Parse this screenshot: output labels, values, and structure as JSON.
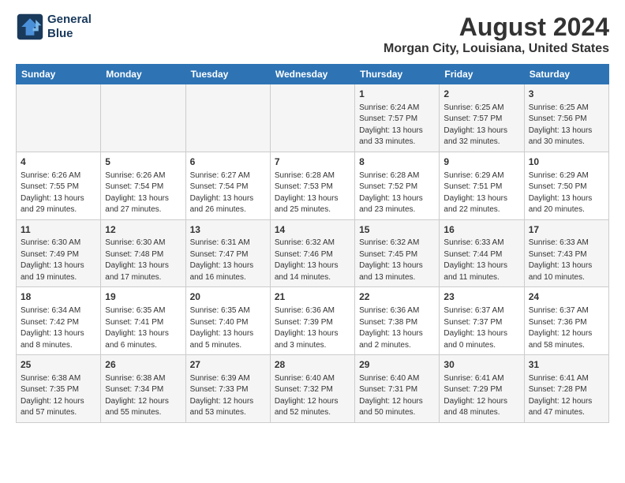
{
  "header": {
    "logo_line1": "General",
    "logo_line2": "Blue",
    "main_title": "August 2024",
    "subtitle": "Morgan City, Louisiana, United States"
  },
  "days_of_week": [
    "Sunday",
    "Monday",
    "Tuesday",
    "Wednesday",
    "Thursday",
    "Friday",
    "Saturday"
  ],
  "weeks": [
    [
      {
        "day": "",
        "content": ""
      },
      {
        "day": "",
        "content": ""
      },
      {
        "day": "",
        "content": ""
      },
      {
        "day": "",
        "content": ""
      },
      {
        "day": "1",
        "content": "Sunrise: 6:24 AM\nSunset: 7:57 PM\nDaylight: 13 hours and 33 minutes."
      },
      {
        "day": "2",
        "content": "Sunrise: 6:25 AM\nSunset: 7:57 PM\nDaylight: 13 hours and 32 minutes."
      },
      {
        "day": "3",
        "content": "Sunrise: 6:25 AM\nSunset: 7:56 PM\nDaylight: 13 hours and 30 minutes."
      }
    ],
    [
      {
        "day": "4",
        "content": "Sunrise: 6:26 AM\nSunset: 7:55 PM\nDaylight: 13 hours and 29 minutes."
      },
      {
        "day": "5",
        "content": "Sunrise: 6:26 AM\nSunset: 7:54 PM\nDaylight: 13 hours and 27 minutes."
      },
      {
        "day": "6",
        "content": "Sunrise: 6:27 AM\nSunset: 7:54 PM\nDaylight: 13 hours and 26 minutes."
      },
      {
        "day": "7",
        "content": "Sunrise: 6:28 AM\nSunset: 7:53 PM\nDaylight: 13 hours and 25 minutes."
      },
      {
        "day": "8",
        "content": "Sunrise: 6:28 AM\nSunset: 7:52 PM\nDaylight: 13 hours and 23 minutes."
      },
      {
        "day": "9",
        "content": "Sunrise: 6:29 AM\nSunset: 7:51 PM\nDaylight: 13 hours and 22 minutes."
      },
      {
        "day": "10",
        "content": "Sunrise: 6:29 AM\nSunset: 7:50 PM\nDaylight: 13 hours and 20 minutes."
      }
    ],
    [
      {
        "day": "11",
        "content": "Sunrise: 6:30 AM\nSunset: 7:49 PM\nDaylight: 13 hours and 19 minutes."
      },
      {
        "day": "12",
        "content": "Sunrise: 6:30 AM\nSunset: 7:48 PM\nDaylight: 13 hours and 17 minutes."
      },
      {
        "day": "13",
        "content": "Sunrise: 6:31 AM\nSunset: 7:47 PM\nDaylight: 13 hours and 16 minutes."
      },
      {
        "day": "14",
        "content": "Sunrise: 6:32 AM\nSunset: 7:46 PM\nDaylight: 13 hours and 14 minutes."
      },
      {
        "day": "15",
        "content": "Sunrise: 6:32 AM\nSunset: 7:45 PM\nDaylight: 13 hours and 13 minutes."
      },
      {
        "day": "16",
        "content": "Sunrise: 6:33 AM\nSunset: 7:44 PM\nDaylight: 13 hours and 11 minutes."
      },
      {
        "day": "17",
        "content": "Sunrise: 6:33 AM\nSunset: 7:43 PM\nDaylight: 13 hours and 10 minutes."
      }
    ],
    [
      {
        "day": "18",
        "content": "Sunrise: 6:34 AM\nSunset: 7:42 PM\nDaylight: 13 hours and 8 minutes."
      },
      {
        "day": "19",
        "content": "Sunrise: 6:35 AM\nSunset: 7:41 PM\nDaylight: 13 hours and 6 minutes."
      },
      {
        "day": "20",
        "content": "Sunrise: 6:35 AM\nSunset: 7:40 PM\nDaylight: 13 hours and 5 minutes."
      },
      {
        "day": "21",
        "content": "Sunrise: 6:36 AM\nSunset: 7:39 PM\nDaylight: 13 hours and 3 minutes."
      },
      {
        "day": "22",
        "content": "Sunrise: 6:36 AM\nSunset: 7:38 PM\nDaylight: 13 hours and 2 minutes."
      },
      {
        "day": "23",
        "content": "Sunrise: 6:37 AM\nSunset: 7:37 PM\nDaylight: 13 hours and 0 minutes."
      },
      {
        "day": "24",
        "content": "Sunrise: 6:37 AM\nSunset: 7:36 PM\nDaylight: 12 hours and 58 minutes."
      }
    ],
    [
      {
        "day": "25",
        "content": "Sunrise: 6:38 AM\nSunset: 7:35 PM\nDaylight: 12 hours and 57 minutes."
      },
      {
        "day": "26",
        "content": "Sunrise: 6:38 AM\nSunset: 7:34 PM\nDaylight: 12 hours and 55 minutes."
      },
      {
        "day": "27",
        "content": "Sunrise: 6:39 AM\nSunset: 7:33 PM\nDaylight: 12 hours and 53 minutes."
      },
      {
        "day": "28",
        "content": "Sunrise: 6:40 AM\nSunset: 7:32 PM\nDaylight: 12 hours and 52 minutes."
      },
      {
        "day": "29",
        "content": "Sunrise: 6:40 AM\nSunset: 7:31 PM\nDaylight: 12 hours and 50 minutes."
      },
      {
        "day": "30",
        "content": "Sunrise: 6:41 AM\nSunset: 7:29 PM\nDaylight: 12 hours and 48 minutes."
      },
      {
        "day": "31",
        "content": "Sunrise: 6:41 AM\nSunset: 7:28 PM\nDaylight: 12 hours and 47 minutes."
      }
    ]
  ]
}
